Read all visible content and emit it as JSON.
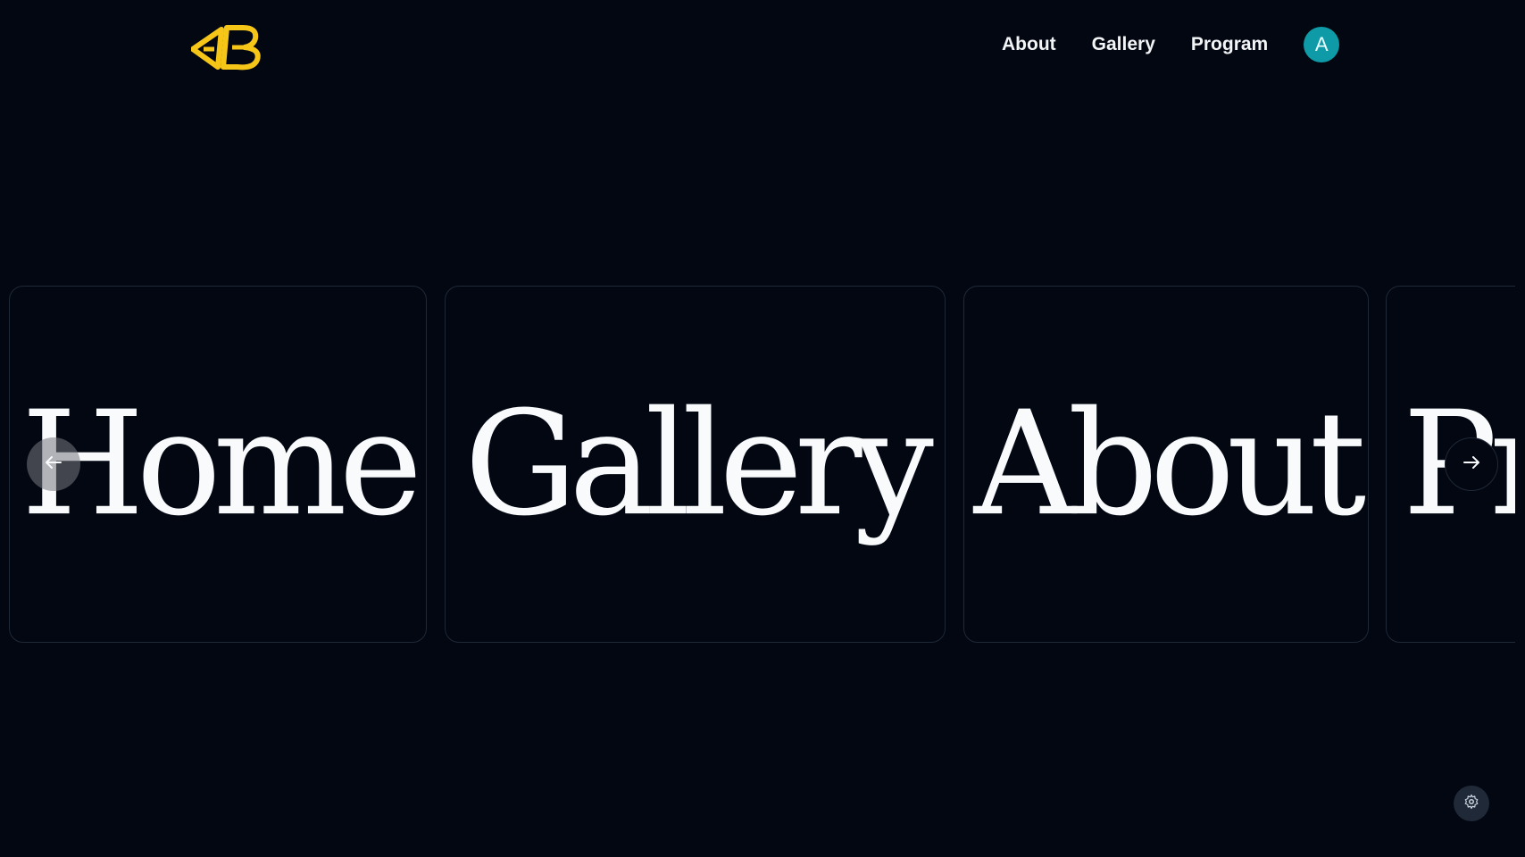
{
  "header": {
    "logo_icon": "ab-logo-icon",
    "brand_color": "#f5c518",
    "nav": [
      {
        "label": "About"
      },
      {
        "label": "Gallery"
      },
      {
        "label": "Program"
      }
    ],
    "avatar_initial": "A",
    "avatar_color": "#0e9aa7"
  },
  "carousel": {
    "cards": [
      {
        "label": "Home"
      },
      {
        "label": "Gallery"
      },
      {
        "label": "About"
      },
      {
        "label": "Pr"
      }
    ],
    "prev_icon": "arrow-left-icon",
    "next_icon": "arrow-right-icon"
  },
  "floating": {
    "settings_icon": "gear-icon"
  }
}
